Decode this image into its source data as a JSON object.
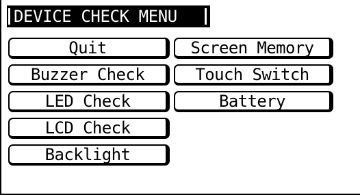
{
  "title": "DEVICE CHECK MENU",
  "left_column": [
    {
      "id": "quit",
      "label": "Quit"
    },
    {
      "id": "buzzer-check",
      "label": "Buzzer Check"
    },
    {
      "id": "led-check",
      "label": "LED Check"
    },
    {
      "id": "lcd-check",
      "label": "LCD Check"
    },
    {
      "id": "backlight",
      "label": "Backlight"
    }
  ],
  "right_column": [
    {
      "id": "screen-memory",
      "label": "Screen Memory"
    },
    {
      "id": "touch-switch",
      "label": "Touch Switch"
    },
    {
      "id": "battery",
      "label": "Battery"
    }
  ],
  "colors": {
    "foreground": "#000000",
    "background": "#ffffff"
  }
}
